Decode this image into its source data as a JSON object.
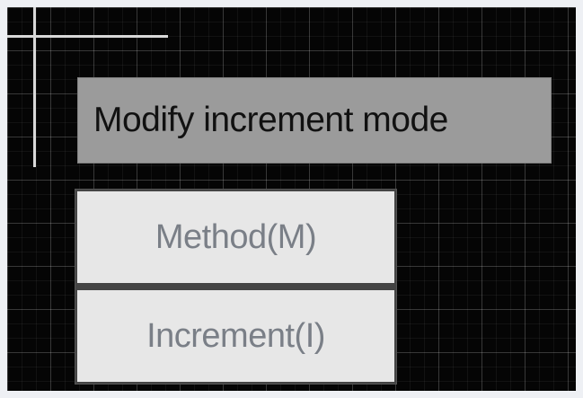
{
  "prompt": {
    "title": "Modify increment mode"
  },
  "menu": {
    "items": [
      {
        "label": "Method(M)"
      },
      {
        "label": "Increment(I)"
      }
    ]
  },
  "colors": {
    "background": "#050505",
    "grid": "#2b2b2b",
    "prompt_bg": "#9b9b9b",
    "menu_bg": "#e7e7e7",
    "menu_text": "#7a7f87"
  }
}
